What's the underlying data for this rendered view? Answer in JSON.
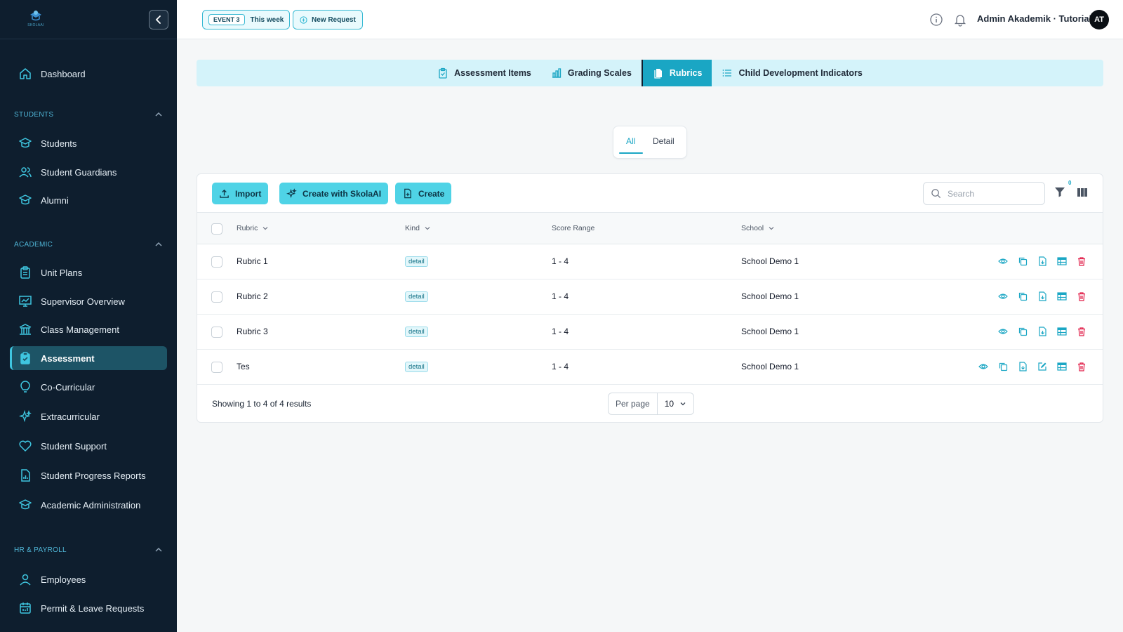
{
  "app": {
    "logo_text": "SKOLAAI",
    "user_name": "Admin Akademik · Tutorial",
    "avatar_initials": "AT"
  },
  "topbar": {
    "event_tag": "EVENT 3",
    "event_range": "This week",
    "new_request": "New Request"
  },
  "sidebar": {
    "dashboard": "Dashboard",
    "sections": [
      {
        "title": "STUDENTS",
        "items": [
          "Students",
          "Student Guardians",
          "Alumni"
        ]
      },
      {
        "title": "ACADEMIC",
        "items": [
          "Unit Plans",
          "Supervisor Overview",
          "Class Management",
          "Assessment",
          "Co-Curricular",
          "Extracurricular",
          "Student Support",
          "Student Progress Reports",
          "Academic Administration"
        ]
      },
      {
        "title": "HR & PAYROLL",
        "items": [
          "Employees",
          "Permit & Leave Requests"
        ]
      }
    ],
    "active_item": "Assessment"
  },
  "module_tabs": [
    {
      "label": "Assessment Items",
      "icon": "clipboard-icon"
    },
    {
      "label": "Grading Scales",
      "icon": "bar-chart-icon"
    },
    {
      "label": "Rubrics",
      "icon": "documents-icon",
      "active": true
    },
    {
      "label": "Child Development Indicators",
      "icon": "list-icon"
    }
  ],
  "view_toggle": {
    "all": "All",
    "detail": "Detail",
    "selected": "All"
  },
  "toolbar": {
    "import": "Import",
    "create_ai": "Create with SkolaAI",
    "create": "Create",
    "search_placeholder": "Search",
    "filter_count": "0"
  },
  "table": {
    "columns": [
      "Rubric",
      "Kind",
      "Score Range",
      "School"
    ],
    "rows": [
      {
        "rubric": "Rubric 1",
        "kind": "detail",
        "score_range": "1 - 4",
        "school": "School Demo 1"
      },
      {
        "rubric": "Rubric 2",
        "kind": "detail",
        "score_range": "1 - 4",
        "school": "School Demo 1"
      },
      {
        "rubric": "Rubric 3",
        "kind": "detail",
        "score_range": "1 - 4",
        "school": "School Demo 1"
      },
      {
        "rubric": "Tes",
        "kind": "detail",
        "score_range": "1 - 4",
        "school": "School Demo 1"
      }
    ]
  },
  "pagination": {
    "summary": "Showing 1 to 4 of 4 results",
    "per_page_label": "Per page",
    "per_page_value": "10"
  },
  "colors": {
    "sidebar_bg": "#0e1e2e",
    "accent": "#1aa6c4",
    "button": "#4fd3e6",
    "danger": "#e11d48"
  }
}
